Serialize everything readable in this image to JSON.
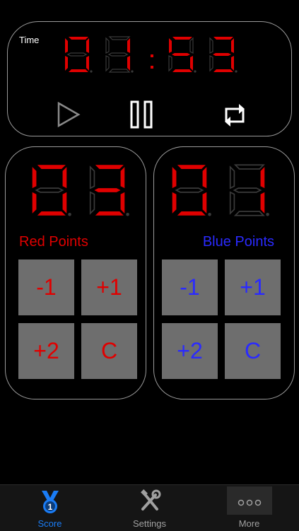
{
  "timer": {
    "label": "Time",
    "digits": [
      "0",
      "1",
      "5",
      "3"
    ],
    "active_color": "#e00000",
    "inactive_color": "#3a3a3a",
    "controls": {
      "play": "play-icon",
      "pause": "pause-icon",
      "reset": "reset-icon"
    }
  },
  "red": {
    "label": "Red Points",
    "score_digits": [
      "0",
      "3"
    ],
    "color": "#e00000",
    "buttons": [
      "-1",
      "+1",
      "+2",
      "C"
    ]
  },
  "blue": {
    "label": "Blue Points",
    "score_digits": [
      "0",
      "1"
    ],
    "color": "#2a2aff",
    "buttons": [
      "-1",
      "+1",
      "+2",
      "C"
    ]
  },
  "tabbar": {
    "tabs": [
      {
        "label": "Score",
        "icon": "medal-icon",
        "selected": true
      },
      {
        "label": "Settings",
        "icon": "tools-icon",
        "selected": false
      },
      {
        "label": "More",
        "icon": "ellipsis-icon",
        "selected": false
      }
    ],
    "selected_color": "#1a7cf5"
  }
}
